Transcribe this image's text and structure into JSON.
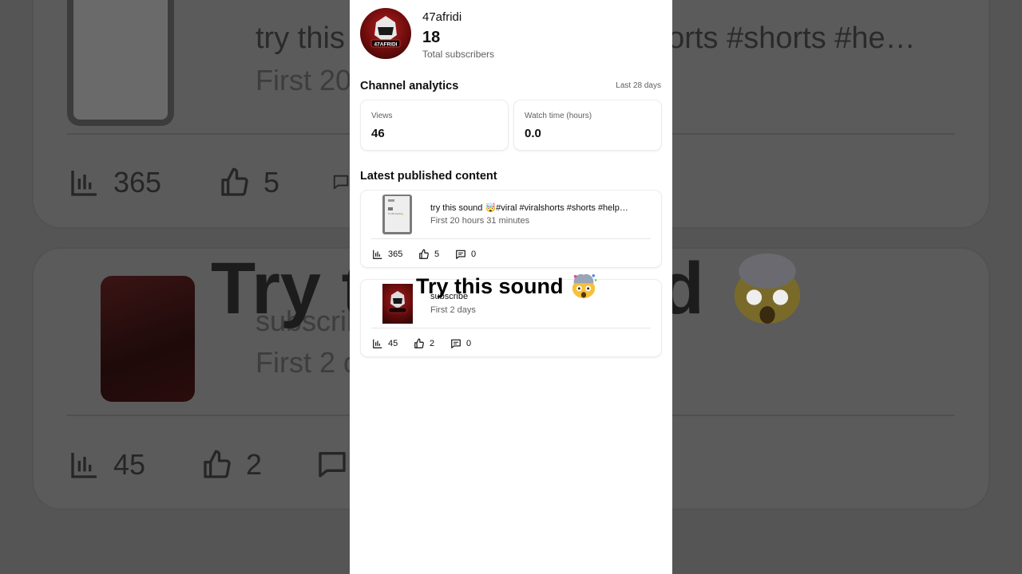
{
  "channel": {
    "name": "47afridi",
    "subscriber_count": "18",
    "subscriber_label": "Total subscribers",
    "avatar_text": "47AFRIDI"
  },
  "analytics": {
    "title": "Channel analytics",
    "range": "Last 28 days",
    "stats": [
      {
        "label": "Views",
        "value": "46"
      },
      {
        "label": "Watch time (hours)",
        "value": "0.0"
      }
    ]
  },
  "latest": {
    "title": "Latest published content",
    "videos": [
      {
        "title": "try this sound 🤯#viral #viralshorts #shorts #help…",
        "meta": "First 20 hours 31 minutes",
        "views": "365",
        "likes": "5",
        "comments": "0",
        "thumb_text": "Try this sound 🤯"
      },
      {
        "title": "subscribe",
        "meta": "First 2 days",
        "views": "45",
        "likes": "2",
        "comments": "0"
      }
    ]
  },
  "overlay": {
    "caption": "Try this sound"
  },
  "background": {
    "title_1": "try this sound 🤯#viral #viralshorts #shorts #help…",
    "meta_1": "First 20 hours 31 minutes",
    "views_1": "365",
    "likes_1": "5",
    "title_2": "subscribe",
    "meta_2": "First 2 days",
    "views_2": "45",
    "likes_2": "2",
    "big_caption": "Try this sound"
  },
  "colors": {
    "text_primary": "#0f0f0f",
    "text_secondary": "#606060",
    "panel_bg": "#ffffff",
    "backdrop": "#555555"
  },
  "icons": [
    "bar-chart-icon",
    "thumb-up-icon",
    "comment-icon",
    "exploding-head-emoji"
  ]
}
